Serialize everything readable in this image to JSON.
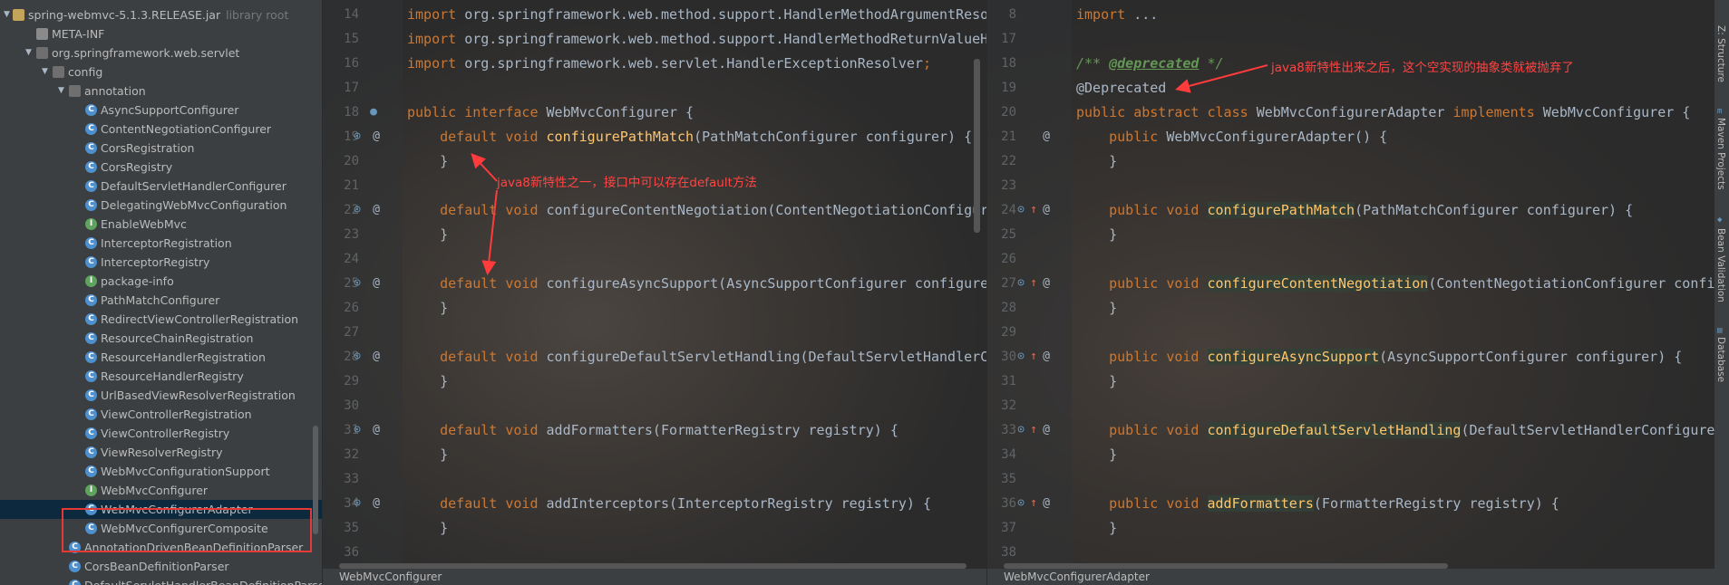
{
  "tree": {
    "jar_label": "spring-webmvc-5.1.3.RELEASE.jar",
    "jar_hint": "library root",
    "items": [
      {
        "label": "META-INF",
        "indent": 0,
        "icon": "folder",
        "arrow": "none"
      },
      {
        "label": "org.springframework.web.servlet",
        "indent": 0,
        "icon": "pkg",
        "arrow": "open"
      },
      {
        "label": "config",
        "indent": 1,
        "icon": "pkg",
        "arrow": "open"
      },
      {
        "label": "annotation",
        "indent": 2,
        "icon": "pkg",
        "arrow": "open"
      },
      {
        "label": "AsyncSupportConfigurer",
        "indent": 3,
        "icon": "class",
        "arrow": "none"
      },
      {
        "label": "ContentNegotiationConfigurer",
        "indent": 3,
        "icon": "class",
        "arrow": "none"
      },
      {
        "label": "CorsRegistration",
        "indent": 3,
        "icon": "class",
        "arrow": "none"
      },
      {
        "label": "CorsRegistry",
        "indent": 3,
        "icon": "class",
        "arrow": "none"
      },
      {
        "label": "DefaultServletHandlerConfigurer",
        "indent": 3,
        "icon": "class",
        "arrow": "none"
      },
      {
        "label": "DelegatingWebMvcConfiguration",
        "indent": 3,
        "icon": "class",
        "arrow": "none"
      },
      {
        "label": "EnableWebMvc",
        "indent": 3,
        "icon": "iface",
        "arrow": "none"
      },
      {
        "label": "InterceptorRegistration",
        "indent": 3,
        "icon": "class",
        "arrow": "none"
      },
      {
        "label": "InterceptorRegistry",
        "indent": 3,
        "icon": "class",
        "arrow": "none"
      },
      {
        "label": "package-info",
        "indent": 3,
        "icon": "iface",
        "arrow": "none"
      },
      {
        "label": "PathMatchConfigurer",
        "indent": 3,
        "icon": "class",
        "arrow": "none"
      },
      {
        "label": "RedirectViewControllerRegistration",
        "indent": 3,
        "icon": "class",
        "arrow": "none"
      },
      {
        "label": "ResourceChainRegistration",
        "indent": 3,
        "icon": "class",
        "arrow": "none"
      },
      {
        "label": "ResourceHandlerRegistration",
        "indent": 3,
        "icon": "class",
        "arrow": "none"
      },
      {
        "label": "ResourceHandlerRegistry",
        "indent": 3,
        "icon": "class",
        "arrow": "none"
      },
      {
        "label": "UrlBasedViewResolverRegistration",
        "indent": 3,
        "icon": "class",
        "arrow": "none"
      },
      {
        "label": "ViewControllerRegistration",
        "indent": 3,
        "icon": "class",
        "arrow": "none"
      },
      {
        "label": "ViewControllerRegistry",
        "indent": 3,
        "icon": "class",
        "arrow": "none"
      },
      {
        "label": "ViewResolverRegistry",
        "indent": 3,
        "icon": "class",
        "arrow": "none"
      },
      {
        "label": "WebMvcConfigurationSupport",
        "indent": 3,
        "icon": "class",
        "arrow": "none"
      },
      {
        "label": "WebMvcConfigurer",
        "indent": 3,
        "icon": "iface",
        "arrow": "none"
      },
      {
        "label": "WebMvcConfigurerAdapter",
        "indent": 3,
        "icon": "class",
        "arrow": "none",
        "selected": true,
        "deprecated": true
      },
      {
        "label": "WebMvcConfigurerComposite",
        "indent": 3,
        "icon": "class",
        "arrow": "none"
      },
      {
        "label": "AnnotationDrivenBeanDefinitionParser",
        "indent": 2,
        "icon": "class",
        "arrow": "none"
      },
      {
        "label": "CorsBeanDefinitionParser",
        "indent": 2,
        "icon": "class",
        "arrow": "none"
      },
      {
        "label": "DefaultServletHandlerBeanDefinitionParser",
        "indent": 2,
        "icon": "class",
        "arrow": "none"
      }
    ]
  },
  "left_editor": {
    "tab": "WebMvcConfigurer",
    "lines": [
      {
        "n": "14",
        "parts": [
          [
            "kw",
            "import "
          ],
          [
            "",
            "org.springframework.web.method.support.HandlerMethodArgumentResolver;"
          ]
        ]
      },
      {
        "n": "15",
        "parts": [
          [
            "kw",
            "import "
          ],
          [
            "",
            "org.springframework.web.method.support.HandlerMethodReturnValueHandler;"
          ]
        ]
      },
      {
        "n": "16",
        "parts": [
          [
            "kw",
            "import "
          ],
          [
            "",
            "org.springframework.web.servlet.HandlerExceptionResolver"
          ],
          [
            "kw",
            ";"
          ]
        ]
      },
      {
        "n": "17",
        "parts": []
      },
      {
        "n": "18",
        "parts": [
          [
            "kw",
            "public interface "
          ],
          [
            "",
            "WebMvcConfigurer {"
          ]
        ]
      },
      {
        "n": "19",
        "parts": [
          [
            "kw",
            "    default void "
          ],
          [
            "fn",
            "configurePathMatch"
          ],
          [
            "",
            "(PathMatchConfigurer configurer) {"
          ]
        ]
      },
      {
        "n": "20",
        "parts": [
          [
            "",
            "    }"
          ]
        ]
      },
      {
        "n": "21",
        "parts": []
      },
      {
        "n": "22",
        "parts": [
          [
            "kw",
            "    default void "
          ],
          [
            "",
            "configureContentNegotiation(ContentNegotiationConfigurer configurer) {"
          ]
        ]
      },
      {
        "n": "23",
        "parts": [
          [
            "",
            "    }"
          ]
        ]
      },
      {
        "n": "24",
        "parts": []
      },
      {
        "n": "25",
        "parts": [
          [
            "kw",
            "    default void "
          ],
          [
            "",
            "configureAsyncSupport(AsyncSupportConfigurer configurer) {"
          ]
        ]
      },
      {
        "n": "26",
        "parts": [
          [
            "",
            "    }"
          ]
        ]
      },
      {
        "n": "27",
        "parts": []
      },
      {
        "n": "28",
        "parts": [
          [
            "kw",
            "    default void "
          ],
          [
            "",
            "configureDefaultServletHandling(DefaultServletHandlerConfigurer configurer) {"
          ]
        ]
      },
      {
        "n": "29",
        "parts": [
          [
            "",
            "    }"
          ]
        ]
      },
      {
        "n": "30",
        "parts": []
      },
      {
        "n": "31",
        "parts": [
          [
            "kw",
            "    default void "
          ],
          [
            "",
            "addFormatters(FormatterRegistry registry) {"
          ]
        ]
      },
      {
        "n": "32",
        "parts": [
          [
            "",
            "    }"
          ]
        ]
      },
      {
        "n": "33",
        "parts": []
      },
      {
        "n": "34",
        "parts": [
          [
            "kw",
            "    default void "
          ],
          [
            "",
            "addInterceptors(InterceptorRegistry registry) {"
          ]
        ]
      },
      {
        "n": "35",
        "parts": [
          [
            "",
            "    }"
          ]
        ]
      },
      {
        "n": "36",
        "parts": []
      }
    ]
  },
  "right_editor": {
    "tab": "WebMvcConfigurerAdapter",
    "lines": [
      {
        "n": "8",
        "parts": [
          [
            "kw",
            "import "
          ],
          [
            "",
            "..."
          ]
        ]
      },
      {
        "n": "17",
        "parts": []
      },
      {
        "n": "18",
        "parts": [
          [
            "cm",
            "/** "
          ],
          [
            "cmtag",
            "@deprecated"
          ],
          [
            "cm",
            " */"
          ]
        ]
      },
      {
        "n": "19",
        "parts": [
          [
            "",
            "@Deprecated"
          ]
        ]
      },
      {
        "n": "20",
        "parts": [
          [
            "kw",
            "public abstract class "
          ],
          [
            "",
            "WebMvcConfigurerAdapter "
          ],
          [
            "kw",
            "implements "
          ],
          [
            "",
            "WebMvcConfigurer {"
          ]
        ]
      },
      {
        "n": "21",
        "parts": [
          [
            "kw",
            "    public "
          ],
          [
            "",
            "WebMvcConfigurerAdapter() {"
          ]
        ]
      },
      {
        "n": "22",
        "parts": [
          [
            "",
            "    }"
          ]
        ]
      },
      {
        "n": "23",
        "parts": []
      },
      {
        "n": "24",
        "parts": [
          [
            "kw",
            "    public void "
          ],
          [
            "hl",
            "configurePathMatch"
          ],
          [
            "",
            "(PathMatchConfigurer configurer) {"
          ]
        ]
      },
      {
        "n": "25",
        "parts": [
          [
            "",
            "    }"
          ]
        ]
      },
      {
        "n": "26",
        "parts": []
      },
      {
        "n": "27",
        "parts": [
          [
            "kw",
            "    public void "
          ],
          [
            "hl",
            "configureContentNegotiation"
          ],
          [
            "",
            "(ContentNegotiationConfigurer configurer) {"
          ]
        ]
      },
      {
        "n": "28",
        "parts": [
          [
            "",
            "    }"
          ]
        ]
      },
      {
        "n": "29",
        "parts": []
      },
      {
        "n": "30",
        "parts": [
          [
            "kw",
            "    public void "
          ],
          [
            "hl",
            "configureAsyncSupport"
          ],
          [
            "",
            "(AsyncSupportConfigurer configurer) {"
          ]
        ]
      },
      {
        "n": "31",
        "parts": [
          [
            "",
            "    }"
          ]
        ]
      },
      {
        "n": "32",
        "parts": []
      },
      {
        "n": "33",
        "parts": [
          [
            "kw",
            "    public void "
          ],
          [
            "hl",
            "configureDefaultServletHandling"
          ],
          [
            "",
            "(DefaultServletHandlerConfigurer configurer) {"
          ]
        ]
      },
      {
        "n": "34",
        "parts": [
          [
            "",
            "    }"
          ]
        ]
      },
      {
        "n": "35",
        "parts": []
      },
      {
        "n": "36",
        "parts": [
          [
            "kw",
            "    public void "
          ],
          [
            "hl",
            "addFormatters"
          ],
          [
            "",
            "(FormatterRegistry registry) {"
          ]
        ]
      },
      {
        "n": "37",
        "parts": [
          [
            "",
            "    }"
          ]
        ]
      },
      {
        "n": "38",
        "parts": []
      }
    ]
  },
  "annotations": {
    "left_note": "java8新特性之一，接口中可以存在default方法",
    "right_note": "java8新特性出来之后，这个空实现的抽象类就被抛弃了"
  },
  "side_tools": [
    "Z: Structure",
    "Maven Projects",
    "Bean Validation",
    "Database"
  ],
  "colors": {
    "annotation_red": "#ff4444",
    "selection": "#0d293e",
    "keyword": "#cc7832"
  }
}
